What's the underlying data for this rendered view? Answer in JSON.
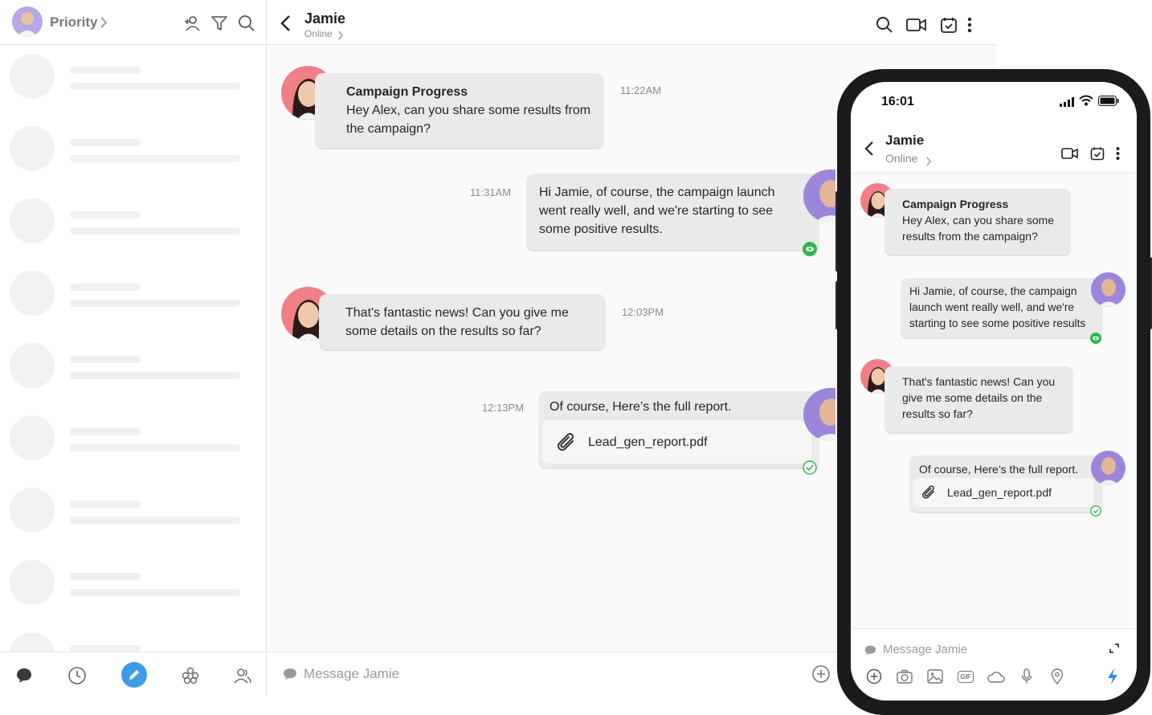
{
  "sidebar": {
    "title": "Priority",
    "footer_nav": [
      "chats",
      "recent",
      "compose",
      "apps",
      "contacts"
    ]
  },
  "chat": {
    "contact_name": "Jamie",
    "contact_status": "Online",
    "composer_placeholder": "Message Jamie",
    "messages": [
      {
        "title": "Campaign Progress",
        "text": "Hey Alex, can you share some results from the campaign?",
        "time": "11:22AM"
      },
      {
        "text": "Hi Jamie, of course, the campaign launch went really well, and we're starting to see some positive results.",
        "time": "11:31AM"
      },
      {
        "text": "That's fantastic news! Can you give me some details on the results so far?",
        "time": "12:03PM"
      },
      {
        "text": "Of course, Here’s the full report.",
        "attachment": "Lead_gen_report.pdf",
        "time": "12:13PM"
      }
    ]
  },
  "phone": {
    "clock": "16:01",
    "contact_name": "Jamie",
    "contact_status": "Online",
    "composer_placeholder": "Message Jamie",
    "messages": [
      {
        "title": "Campaign Progress",
        "text": "Hey Alex, can you share some results from the campaign?"
      },
      {
        "text": "Hi Jamie, of course, the campaign launch went really well, and we're starting to see some positive results"
      },
      {
        "text": "That's fantastic news! Can you give me some details on the results so far?"
      },
      {
        "text": "Of course, Here’s the full report.",
        "attachment": "Lead_gen_report.pdf"
      }
    ],
    "gif_label": "GIF"
  },
  "colors": {
    "accent": "#3f9be6",
    "read_green": "#2fb84a",
    "bubble": "#eaeaea",
    "send": "#2f8fe8"
  }
}
